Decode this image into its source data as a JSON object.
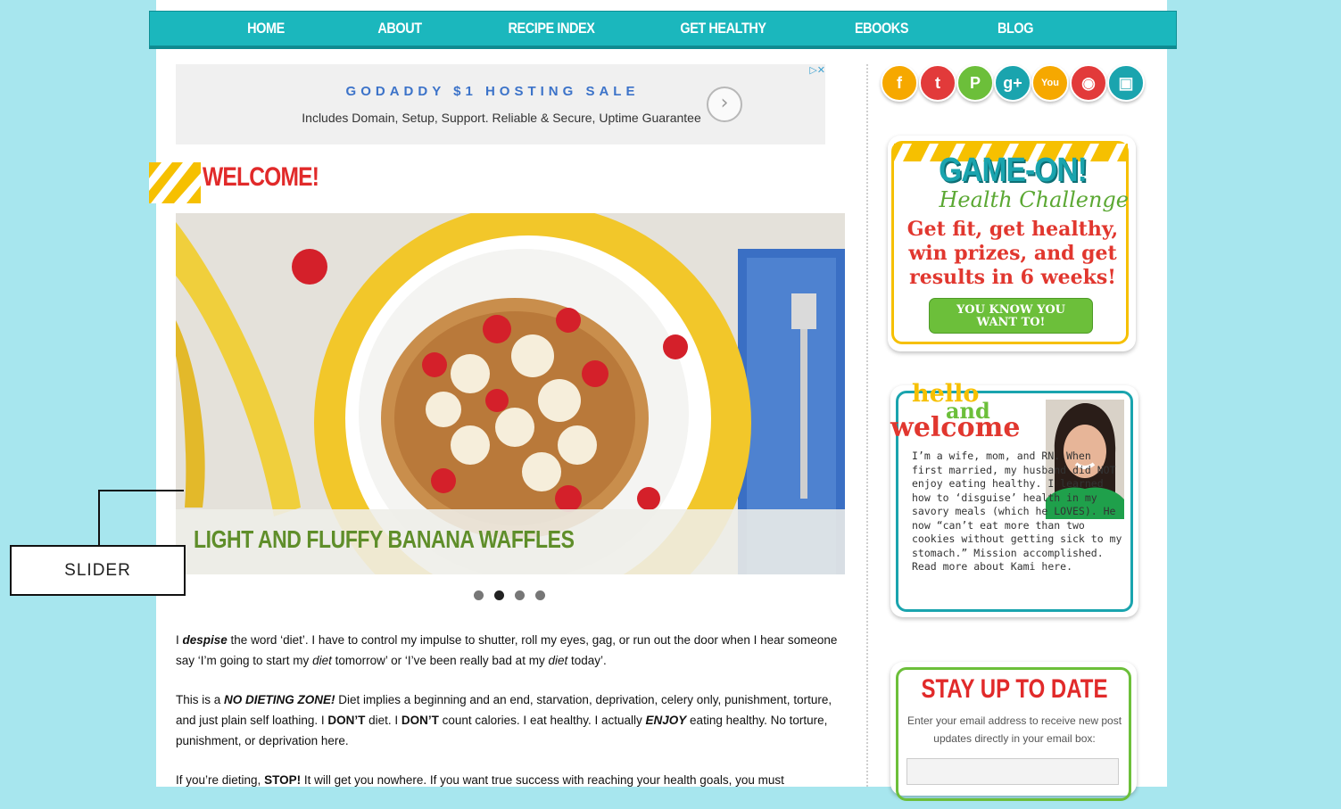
{
  "nav": {
    "items": [
      "HOME",
      "ABOUT",
      "RECIPE INDEX",
      "GET HEALTHY",
      "EBOOKS",
      "BLOG"
    ]
  },
  "ad": {
    "title": "GODADDY $1 HOSTING SALE",
    "subtitle": "Includes Domain, Setup, Support. Reliable & Secure, Uptime Guarantee",
    "arrow": "›",
    "controls": "▷✕"
  },
  "welcome": {
    "title": "WELCOME!"
  },
  "slider": {
    "caption": "LIGHT AND FLUFFY BANANA WAFFLES",
    "slide_count": 4,
    "active_slide": 2
  },
  "annotation": {
    "label": "SLIDER"
  },
  "body": {
    "p1": {
      "a": "I ",
      "b": "despise",
      "c": " the word ‘diet’.  I have to control my impulse to shutter, roll my eyes, gag, or run out the door when I hear someone say ‘I’m going to start my ",
      "d": "diet",
      "e": " tomorrow’ or ‘I’ve been really bad at my ",
      "f": "diet",
      "g": " today’."
    },
    "p2": {
      "a": "This is a ",
      "b": "NO DIETING ZONE!",
      "c": "  Diet implies a beginning and an end, starvation, deprivation, celery only, punishment, torture, and just plain self loathing.  I ",
      "d": "DON’T",
      "e": " diet.  I ",
      "f": "DON’T",
      "g": " count calories.  I eat healthy.  I actually ",
      "h": "ENJOY",
      "i": " eating healthy.  No torture, punishment, or deprivation here."
    },
    "p3": {
      "a": "If you’re dieting, ",
      "b": "STOP!",
      "c": "  It will get you nowhere.  If you want true success with reaching your health goals, you must"
    }
  },
  "social": [
    {
      "name": "facebook-icon",
      "glyph": "f",
      "color": "#f6a800"
    },
    {
      "name": "twitter-icon",
      "glyph": "t",
      "color": "#e23a3a"
    },
    {
      "name": "pinterest-icon",
      "glyph": "P",
      "color": "#6cbf3a"
    },
    {
      "name": "google-plus-icon",
      "glyph": "g+",
      "color": "#1aa4ae"
    },
    {
      "name": "youtube-icon",
      "glyph": "You",
      "color": "#f6a800"
    },
    {
      "name": "rss-icon",
      "glyph": "◉",
      "color": "#e23a3a"
    },
    {
      "name": "instagram-icon",
      "glyph": "▣",
      "color": "#1aa4ae"
    }
  ],
  "game_on": {
    "title": "GAME-ON!",
    "subtitle": "Health Challenge",
    "line1": "Get fit, get healthy,",
    "line2": "win prizes, and get",
    "line3": "results in 6 weeks!",
    "button_line1": "YOU KNOW YOU",
    "button_line2": "WANT TO!"
  },
  "hello": {
    "w1": "hello",
    "w2": "and",
    "w3": "welcome",
    "text": "I’m a wife, mom, and RN. When first married, my husband did NOT enjoy eating healthy. I learned how to ‘disguise’ health in my savory meals (which he LOVES). He now “can’t eat more than two cookies without getting sick to my stomach.” Mission accomplished. Read more about Kami here."
  },
  "stay": {
    "title": "STAY UP TO DATE",
    "text": "Enter your email address to receive new post updates directly in your email box:",
    "input_placeholder": ""
  },
  "colors": {
    "background": "#a7e6ee",
    "nav": "#1bb7bd",
    "welcome_red": "#e12a2a",
    "caption_green": "#5f8e2a",
    "accent_yellow": "#f6c000"
  }
}
